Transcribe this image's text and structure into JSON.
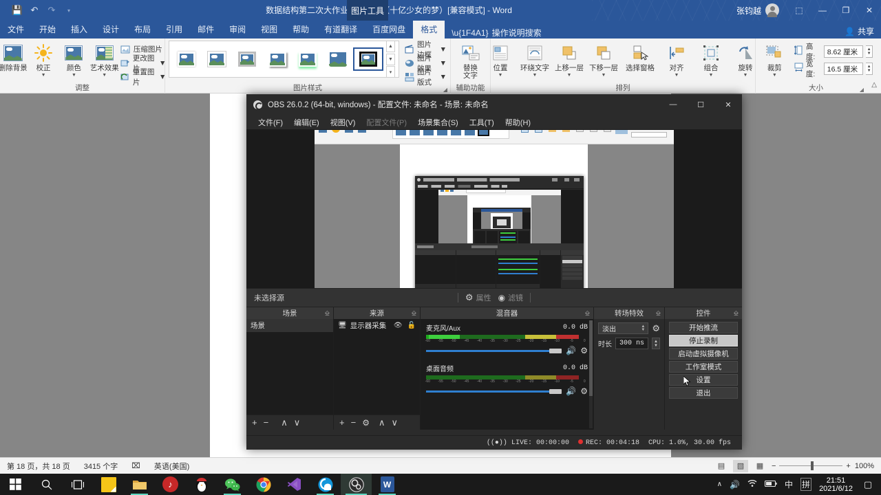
{
  "word": {
    "title": "数据结构第二次大作业-220宿舍（十亿少女的梦）[兼容模式] - Word",
    "contextual_tab": "图片工具",
    "user_name": "张钧越",
    "share_label": "共享",
    "quick_access": [
      {
        "name": "save-icon",
        "glyph": "💾"
      },
      {
        "name": "undo-icon",
        "glyph": "↶"
      },
      {
        "name": "redo-icon",
        "glyph": "↷"
      },
      {
        "name": "customize-qat-icon",
        "glyph": "▾"
      }
    ],
    "window_buttons": [
      {
        "name": "ribbon-display-options-icon",
        "glyph": "⬚"
      },
      {
        "name": "minimize-icon",
        "glyph": "—"
      },
      {
        "name": "restore-icon",
        "glyph": "❐"
      },
      {
        "name": "close-icon",
        "glyph": "✕"
      }
    ],
    "tabs": [
      "文件",
      "开始",
      "插入",
      "设计",
      "布局",
      "引用",
      "邮件",
      "审阅",
      "视图",
      "帮助",
      "有道翻译",
      "百度网盘",
      "格式"
    ],
    "active_tab": "格式",
    "tell_me": "操作说明搜索",
    "ribbon": {
      "groups": [
        {
          "label": "调整",
          "big_buttons": [
            {
              "name": "remove-background-button",
              "label": "删除背景",
              "caret": false
            },
            {
              "name": "corrections-button",
              "label": "校正",
              "caret": true
            },
            {
              "name": "color-button",
              "label": "颜色",
              "caret": true
            },
            {
              "name": "artistic-effects-button",
              "label": "艺术效果",
              "caret": true
            }
          ],
          "small_buttons": [
            {
              "name": "compress-pictures-button",
              "label": "压缩图片",
              "caret": false
            },
            {
              "name": "change-picture-button",
              "label": "更改图片",
              "caret": true
            },
            {
              "name": "reset-picture-button",
              "label": "重置图片",
              "caret": true
            }
          ]
        },
        {
          "label": "图片样式",
          "gallery_count": 7,
          "selected_index": 6,
          "small_buttons": [
            {
              "name": "picture-border-button",
              "label": "图片边框",
              "caret": true
            },
            {
              "name": "picture-effects-button",
              "label": "图片效果",
              "caret": true
            },
            {
              "name": "picture-layout-button",
              "label": "图片版式",
              "caret": true
            }
          ]
        },
        {
          "label": "辅助功能",
          "big_buttons": [
            {
              "name": "alt-text-button",
              "label": "替换\n文字",
              "caret": false
            }
          ]
        },
        {
          "label": "排列",
          "big_buttons": [
            {
              "name": "position-button",
              "label": "位置",
              "caret": true
            },
            {
              "name": "wrap-text-button",
              "label": "环绕文字",
              "caret": true
            },
            {
              "name": "bring-forward-button",
              "label": "上移一层",
              "caret": true
            },
            {
              "name": "send-backward-button",
              "label": "下移一层",
              "caret": true
            },
            {
              "name": "selection-pane-button",
              "label": "选择窗格",
              "caret": false
            },
            {
              "name": "align-button",
              "label": "对齐",
              "caret": true
            },
            {
              "name": "group-button",
              "label": "组合",
              "caret": true
            },
            {
              "name": "rotate-button",
              "label": "旋转",
              "caret": true
            }
          ]
        },
        {
          "label": "大小",
          "big_buttons": [
            {
              "name": "crop-button",
              "label": "裁剪",
              "caret": true
            }
          ],
          "fields": [
            {
              "name": "shape-height-field",
              "label": "高度:",
              "value": "8.62 厘米"
            },
            {
              "name": "shape-width-field",
              "label": "宽度:",
              "value": "16.5 厘米"
            }
          ]
        }
      ]
    },
    "status": {
      "page": "第 18 页，共 18 页",
      "words": "3415 个字",
      "proof_icon": "⌧",
      "language": "英语(美国)",
      "views": [
        {
          "name": "read-mode-view-button",
          "glyph": "▤"
        },
        {
          "name": "print-layout-view-button",
          "glyph": "▧"
        },
        {
          "name": "web-layout-view-button",
          "glyph": "▦"
        }
      ],
      "zoom_out": "−",
      "zoom_in": "+",
      "zoom_level": "100%"
    }
  },
  "obs": {
    "title": "OBS 26.0.2 (64-bit, windows) - 配置文件: 未命名 - 场景: 未命名",
    "window_buttons": [
      {
        "name": "minimize-icon",
        "glyph": "—"
      },
      {
        "name": "maximize-icon",
        "glyph": "☐"
      },
      {
        "name": "close-icon",
        "glyph": "✕"
      }
    ],
    "menu": [
      {
        "label": "文件(F)",
        "disabled": false
      },
      {
        "label": "编辑(E)",
        "disabled": false
      },
      {
        "label": "视图(V)",
        "disabled": false
      },
      {
        "label": "配置文件(P)",
        "disabled": true
      },
      {
        "label": "场景集合(S)",
        "disabled": false
      },
      {
        "label": "工具(T)",
        "disabled": false
      },
      {
        "label": "帮助(H)",
        "disabled": false
      }
    ],
    "source_bar": {
      "no_source_label": "未选择源",
      "properties_label": "属性",
      "filters_label": "滤镜"
    },
    "docks": {
      "scenes": {
        "title": "场景",
        "items": [
          "场景"
        ],
        "toolbar": [
          "+",
          "−",
          "∧",
          "∨"
        ]
      },
      "sources": {
        "title": "来源",
        "items": [
          {
            "label": "显示器采集",
            "icon": "monitor-icon"
          }
        ],
        "toolbar": [
          "+",
          "−",
          "⚙",
          "∧",
          "∨"
        ]
      },
      "mixer": {
        "title": "混音器",
        "channels": [
          {
            "name": "麦克风/Aux",
            "db": "0.0 dB",
            "level": 12
          },
          {
            "name": "桌面音频",
            "db": "0.0 dB",
            "level": 0
          }
        ],
        "ticks": [
          "-60",
          "-55",
          "-50",
          "-45",
          "-40",
          "-35",
          "-30",
          "-25",
          "-20",
          "-15",
          "-10",
          "-5",
          "0"
        ]
      },
      "transitions": {
        "title": "转场特效",
        "selected": "淡出",
        "duration_label": "时长",
        "duration_value": "300 ns"
      },
      "controls": {
        "title": "控件",
        "buttons": [
          {
            "name": "start-streaming-button",
            "label": "开始推流",
            "hover": false
          },
          {
            "name": "stop-recording-button",
            "label": "停止录制",
            "hover": true
          },
          {
            "name": "start-virtual-camera-button",
            "label": "启动虚拟摄像机",
            "hover": false
          },
          {
            "name": "studio-mode-button",
            "label": "工作室模式",
            "hover": false
          },
          {
            "name": "settings-button",
            "label": "设置",
            "hover": false
          },
          {
            "name": "exit-button",
            "label": "退出",
            "hover": false
          }
        ]
      }
    },
    "status": {
      "live_label": "LIVE: 00:00:00",
      "rec_label": "REC: 00:04:18",
      "cpu_label": "CPU: 1.0%, 30.00 fps"
    }
  },
  "taskbar": {
    "items": [
      {
        "name": "start-button",
        "glyph": "⊞",
        "kind": "start",
        "state": "none"
      },
      {
        "name": "search-icon",
        "glyph": "⚲",
        "kind": "search",
        "state": "none"
      },
      {
        "name": "task-view-icon",
        "glyph": "❑",
        "kind": "taskview",
        "state": "none"
      },
      {
        "name": "sticky-notes-icon",
        "glyph": "",
        "kind": "sticky",
        "state": "none"
      },
      {
        "name": "file-explorer-icon",
        "glyph": "",
        "kind": "explorer",
        "state": "open"
      },
      {
        "name": "netease-music-icon",
        "glyph": "",
        "kind": "netease",
        "state": "none"
      },
      {
        "name": "qq-icon",
        "glyph": "",
        "kind": "qq",
        "state": "none"
      },
      {
        "name": "wechat-icon",
        "glyph": "",
        "kind": "wechat",
        "state": "open"
      },
      {
        "name": "chrome-icon",
        "glyph": "",
        "kind": "chrome",
        "state": "none"
      },
      {
        "name": "vscode-icon",
        "glyph": "",
        "kind": "vscode",
        "state": "none"
      },
      {
        "name": "quark-browser-icon",
        "glyph": "",
        "kind": "quark",
        "state": "open"
      },
      {
        "name": "obs-icon",
        "glyph": "",
        "kind": "obs",
        "state": "active"
      },
      {
        "name": "word-icon",
        "glyph": "W",
        "kind": "word",
        "state": "open"
      }
    ],
    "tray": [
      {
        "name": "show-hidden-icons-icon",
        "glyph": "∧"
      },
      {
        "name": "volume-icon",
        "glyph": "🔊"
      },
      {
        "name": "network-icon",
        "glyph": "◠"
      },
      {
        "name": "battery-icon",
        "glyph": "▭"
      },
      {
        "name": "ime-mode-icon",
        "glyph": "中"
      },
      {
        "name": "ime-pinyin-icon",
        "glyph": "拼"
      }
    ],
    "clock_time": "21:51",
    "clock_date": "2021/6/12",
    "notification_icon": "▢"
  }
}
